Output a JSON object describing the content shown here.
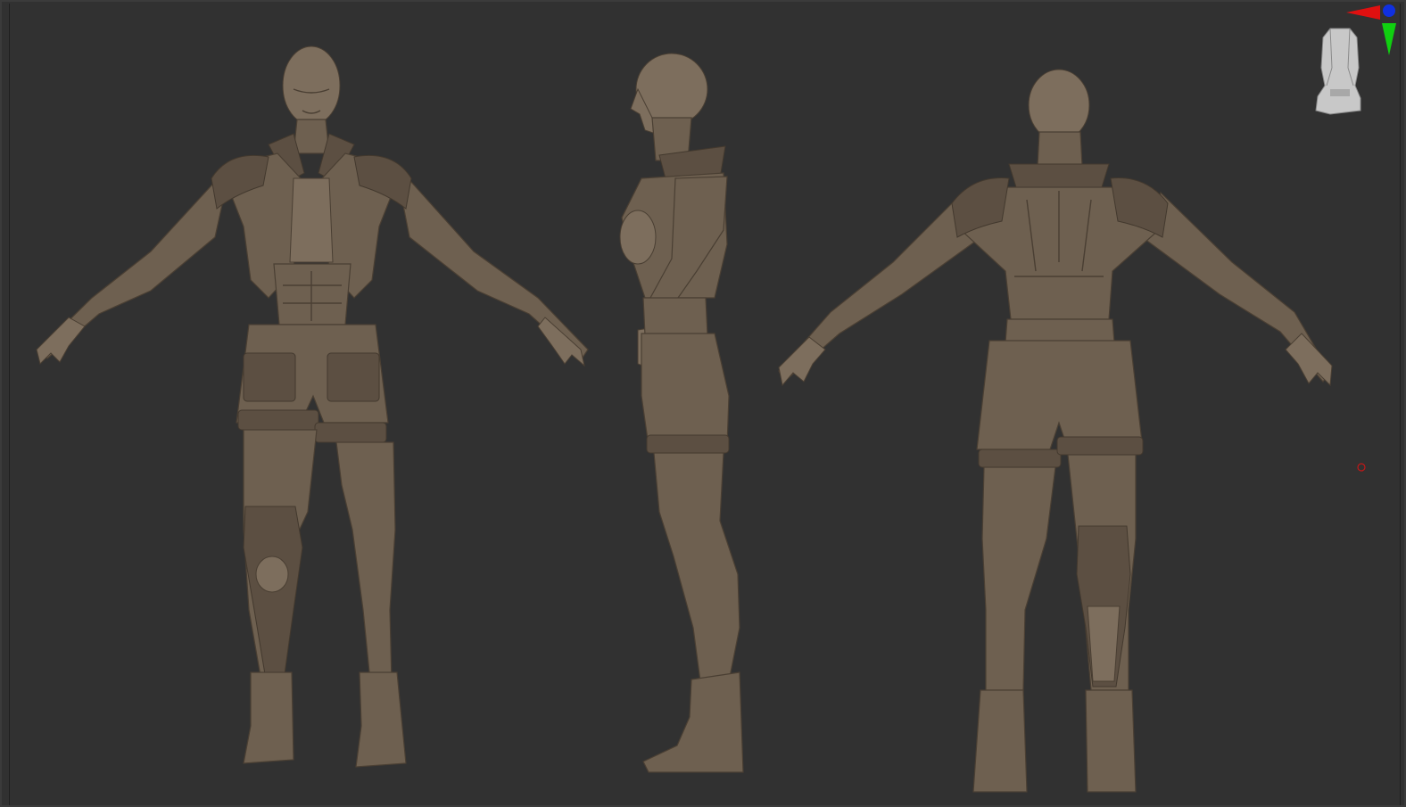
{
  "viewport": {
    "background_color": "#313131",
    "material_color": "#6e6050"
  },
  "views": [
    {
      "name": "front-view"
    },
    {
      "name": "side-view"
    },
    {
      "name": "back-view"
    }
  ],
  "navigator": {
    "axis_colors": {
      "x": "#e01010",
      "y": "#10d010",
      "z": "#1030e0"
    }
  },
  "pivot_marker_color": "#c01818"
}
